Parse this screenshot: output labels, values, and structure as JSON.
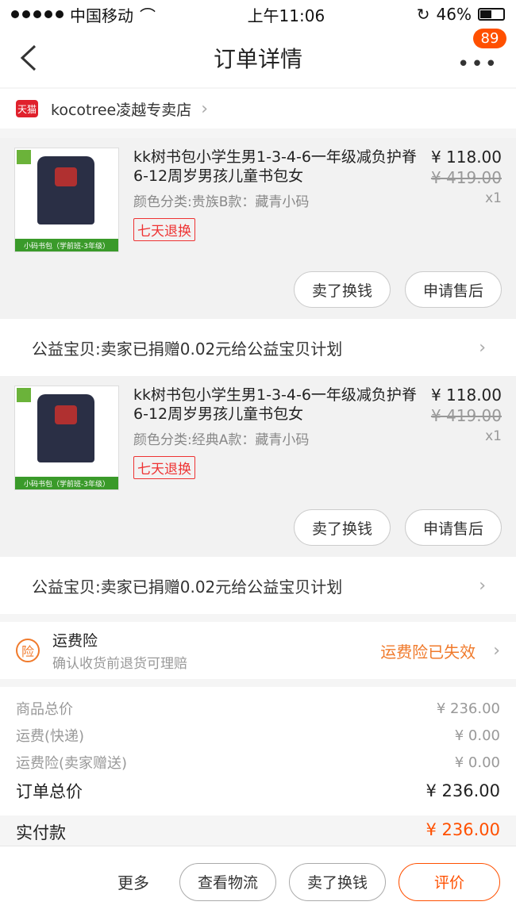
{
  "status": {
    "carrier": "中国移动",
    "time": "上午11:06",
    "battery": "46%"
  },
  "nav": {
    "title": "订单详情",
    "badge": "89",
    "more_label": "•••"
  },
  "store": {
    "badge": "天猫",
    "name": "kocotree凌越专卖店"
  },
  "items": [
    {
      "title": "kk树书包小学生男1-3-4-6一年级减负护脊6-12周岁男孩儿童书包女",
      "sku": "颜色分类:贵族B款：藏青小码",
      "tag": "七天退换",
      "price": "¥ 118.00",
      "original_price": "¥ 419.00",
      "qty": "x1",
      "thumb_strip": "小码书包（学前班-3年级）",
      "actions": [
        "卖了换钱",
        "申请售后"
      ],
      "charity": "公益宝贝:卖家已捐赠0.02元给公益宝贝计划"
    },
    {
      "title": "kk树书包小学生男1-3-4-6一年级减负护脊6-12周岁男孩儿童书包女",
      "sku": "颜色分类:经典A款：藏青小码",
      "tag": "七天退换",
      "price": "¥ 118.00",
      "original_price": "¥ 419.00",
      "qty": "x1",
      "thumb_strip": "小码书包（学前班-3年级）",
      "actions": [
        "卖了换钱",
        "申请售后"
      ],
      "charity": "公益宝贝:卖家已捐赠0.02元给公益宝贝计划"
    }
  ],
  "insurance": {
    "icon": "险",
    "title": "运费险",
    "desc": "确认收货前退货可理赔",
    "status": "运费险已失效"
  },
  "summary": {
    "rows": [
      {
        "label": "商品总价",
        "value": "¥ 236.00"
      },
      {
        "label": "运费(快递)",
        "value": "¥ 0.00"
      },
      {
        "label": "运费险(卖家赠送)",
        "value": "¥ 0.00"
      }
    ],
    "total_label": "订单总价",
    "total_value": "¥ 236.00",
    "paid_label": "实付款",
    "paid_value": "¥ 236.00"
  },
  "bottom": {
    "more": "更多",
    "logistics": "查看物流",
    "sell": "卖了换钱",
    "review": "评价"
  }
}
